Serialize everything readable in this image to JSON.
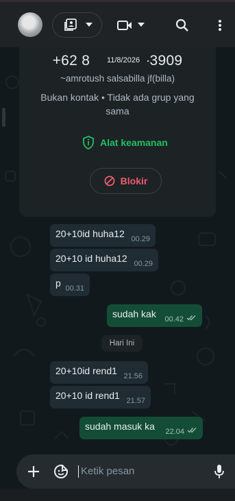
{
  "header": {
    "avatar": "contact-avatar",
    "media_icon": "media-gallery-icon",
    "media_dropdown_icon": "chevron-down-icon",
    "video_icon": "video-camera-icon",
    "video_dropdown_icon": "chevron-down-icon",
    "search_icon": "search-icon",
    "menu_icon": "more-vert-icon"
  },
  "contact": {
    "phone_start": "+62 8",
    "phone_end": "3-3909",
    "date_overlay": "11/8/2026",
    "name": "~amrotush salsabilla jf(billa)",
    "subtitle": "Bukan kontak • Tidak ada grup yang sama",
    "security_label": "Alat keamanan",
    "block_label": "Blokir"
  },
  "messages": [
    {
      "direction": "in",
      "text": "20+10id huha12",
      "time": "00.29"
    },
    {
      "direction": "in",
      "text": "20+10 id huha12",
      "time": "00.29"
    },
    {
      "direction": "in",
      "text": "p",
      "time": "00.31"
    },
    {
      "direction": "out",
      "text": "sudah kak",
      "time": "00.42",
      "status": "read"
    },
    {
      "direction": "in",
      "text": "20+10id rend1",
      "time": "21.56"
    },
    {
      "direction": "in",
      "text": "20+10 id rend1",
      "time": "21.57"
    },
    {
      "direction": "out",
      "text": "sudah masuk ka",
      "time": "22.04",
      "status": "read"
    }
  ],
  "day_separator": "Hari Ini",
  "composer": {
    "placeholder": "Ketik pesan",
    "add_icon": "plus-icon",
    "sticker_icon": "sticker-icon",
    "mic_icon": "microphone-icon"
  },
  "colors": {
    "accent_green": "#21c063",
    "block_red": "#f15c6d",
    "outgoing_bubble": "#144d37",
    "incoming_bubble": "#202c33"
  }
}
